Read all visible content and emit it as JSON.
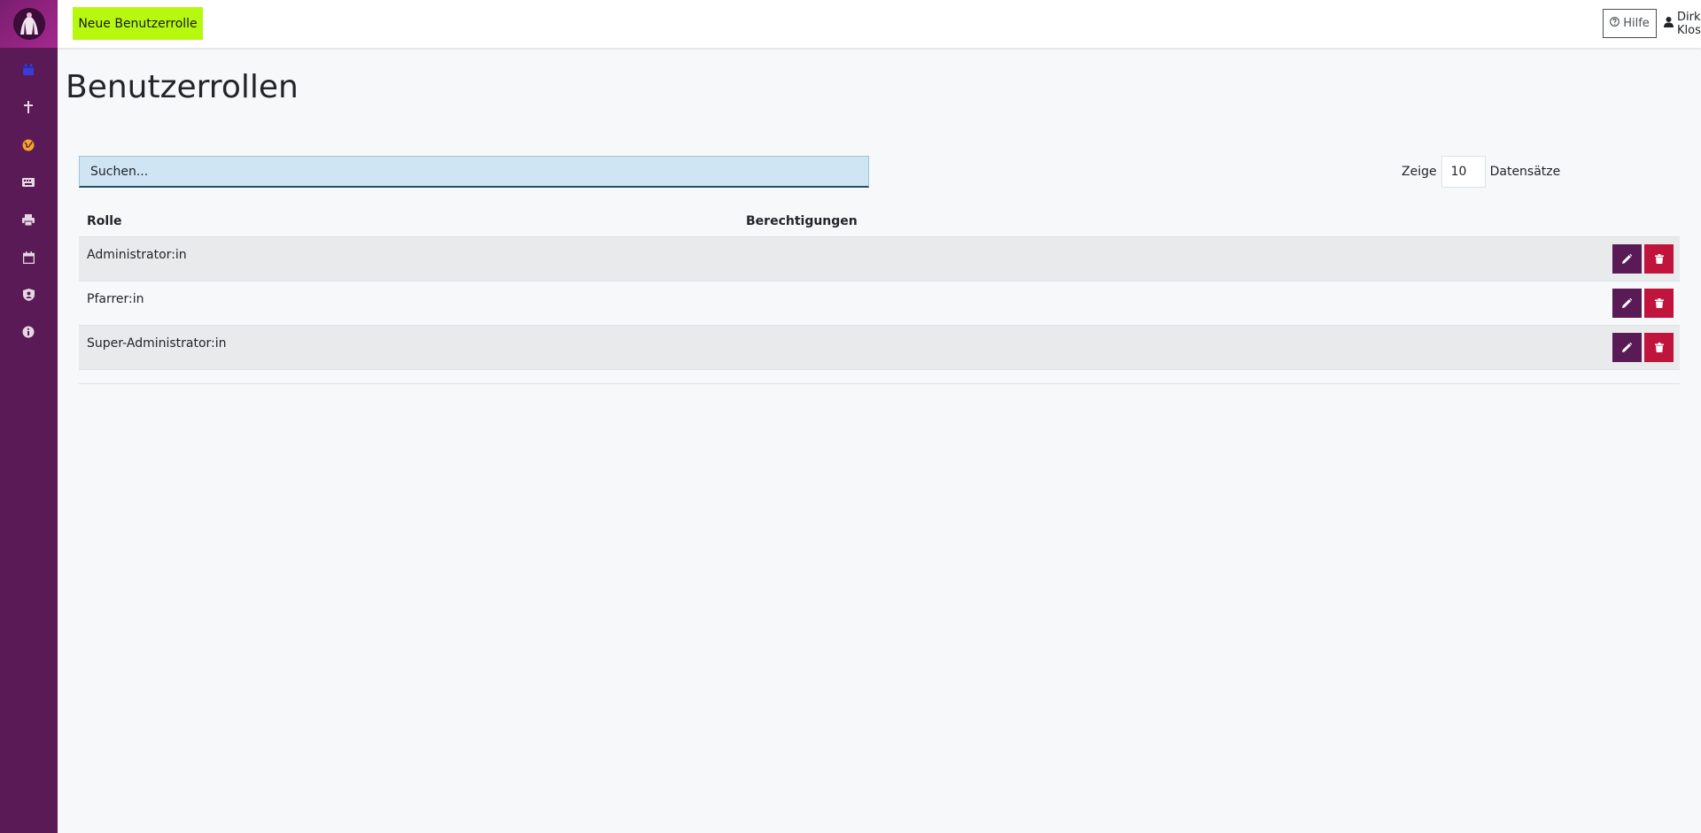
{
  "colors": {
    "sidebar": "#5a1a55",
    "accent_new": "#b6f90f",
    "edit_button": "#5a1a55",
    "delete_button": "#c0143c",
    "search_bg": "#cfe5f3"
  },
  "sidebar": {
    "items": [
      {
        "icon": "calendar-check-icon"
      },
      {
        "icon": "cross-icon"
      },
      {
        "icon": "globe-icon"
      },
      {
        "icon": "keyboard-icon"
      },
      {
        "icon": "printer-icon"
      },
      {
        "icon": "calendar-icon"
      },
      {
        "icon": "user-shield-icon"
      },
      {
        "icon": "info-icon"
      }
    ]
  },
  "topbar": {
    "new_button": "Neue Benutzerrolle",
    "help_button": "Hilfe",
    "user_name": "Dirk Klose"
  },
  "page": {
    "title": "Benutzerrollen"
  },
  "search": {
    "placeholder": "Suchen..."
  },
  "pagination": {
    "show_label": "Zeige",
    "page_size": "10",
    "records_label": "Datensätze"
  },
  "table": {
    "headers": {
      "role": "Rolle",
      "permissions": "Berechtigungen"
    },
    "rows": [
      {
        "role": "Administrator:in",
        "permissions": ""
      },
      {
        "role": "Pfarrer:in",
        "permissions": ""
      },
      {
        "role": "Super-Administrator:in",
        "permissions": ""
      }
    ]
  }
}
